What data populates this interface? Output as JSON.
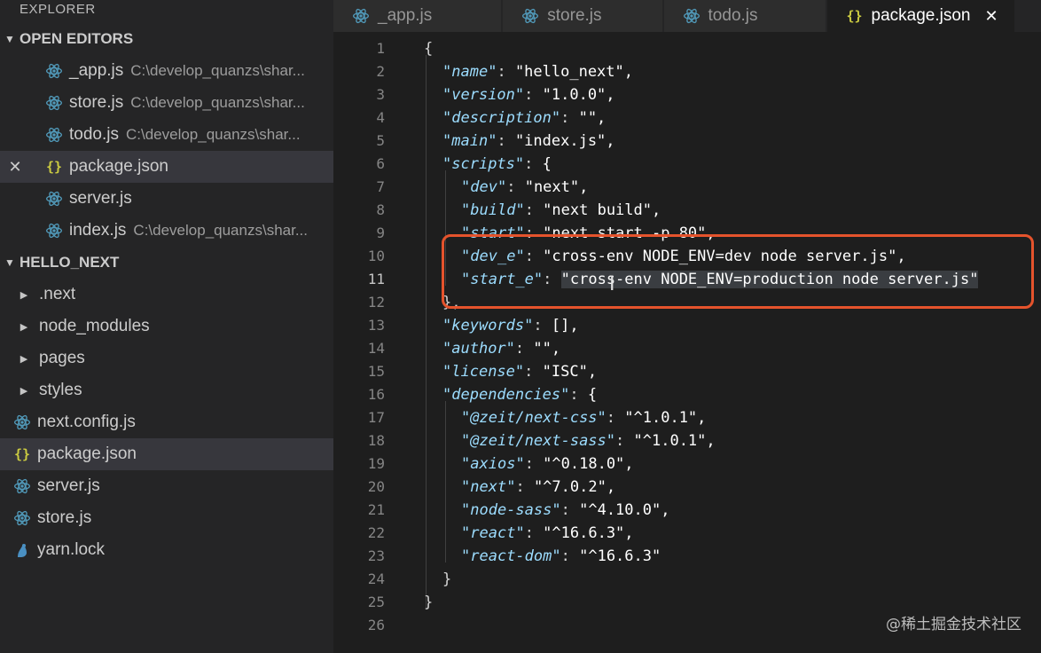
{
  "explorer": {
    "title": "EXPLORER",
    "open_editors": {
      "label": "OPEN EDITORS",
      "items": [
        {
          "name": "_app.js",
          "path": "C:\\develop_quanzs\\shar..."
        },
        {
          "name": "store.js",
          "path": "C:\\develop_quanzs\\shar..."
        },
        {
          "name": "todo.js",
          "path": "C:\\develop_quanzs\\shar..."
        },
        {
          "name": "package.json",
          "path": ""
        },
        {
          "name": "server.js",
          "path": ""
        },
        {
          "name": "index.js",
          "path": "C:\\develop_quanzs\\shar..."
        }
      ]
    },
    "project": {
      "label": "HELLO_NEXT",
      "folders": [
        ".next",
        "node_modules",
        "pages",
        "styles"
      ],
      "files": [
        "next.config.js",
        "package.json",
        "server.js",
        "store.js",
        "yarn.lock"
      ]
    }
  },
  "tabs": [
    {
      "label": "_app.js"
    },
    {
      "label": "store.js"
    },
    {
      "label": "todo.js"
    },
    {
      "label": "package.json"
    }
  ],
  "editor": {
    "line_numbers": [
      "1",
      "2",
      "3",
      "4",
      "5",
      "6",
      "7",
      "8",
      "9",
      "10",
      "11",
      "12",
      "13",
      "14",
      "15",
      "16",
      "17",
      "18",
      "19",
      "20",
      "21",
      "22",
      "23",
      "24",
      "25",
      "26"
    ],
    "current_line": 11,
    "lines": [
      {
        "k": "",
        "v": "{"
      },
      {
        "k": "name",
        "v": "\"hello_next\","
      },
      {
        "k": "version",
        "v": "\"1.0.0\","
      },
      {
        "k": "description",
        "v": "\"\","
      },
      {
        "k": "main",
        "v": "\"index.js\","
      },
      {
        "k": "scripts",
        "v": "{"
      },
      {
        "k": "dev",
        "v": "\"next\","
      },
      {
        "k": "build",
        "v": "\"next build\","
      },
      {
        "k": "start",
        "v": "\"next start -p 80\","
      },
      {
        "k": "dev_e",
        "v": "\"cross-env NODE_ENV=dev node server.js\","
      },
      {
        "k": "start_e",
        "v": "\"cross-env NODE_ENV=production node server.js\""
      },
      {
        "k": "",
        "v": "},"
      },
      {
        "k": "keywords",
        "v": "[],"
      },
      {
        "k": "author",
        "v": "\"\","
      },
      {
        "k": "license",
        "v": "\"ISC\","
      },
      {
        "k": "dependencies",
        "v": "{"
      },
      {
        "k": "@zeit/next-css",
        "v": "\"^1.0.1\","
      },
      {
        "k": "@zeit/next-sass",
        "v": "\"^1.0.1\","
      },
      {
        "k": "axios",
        "v": "\"^0.18.0\","
      },
      {
        "k": "next",
        "v": "\"^7.0.2\","
      },
      {
        "k": "node-sass",
        "v": "\"^4.10.0\","
      },
      {
        "k": "react",
        "v": "\"^16.6.3\","
      },
      {
        "k": "react-dom",
        "v": "\"^16.6.3\""
      },
      {
        "k": "",
        "v": "}"
      },
      {
        "k": "",
        "v": "}"
      },
      {
        "k": "",
        "v": ""
      }
    ]
  },
  "watermark": "@稀土掘金技术社区",
  "colors": {
    "accent_box": "#e5532c",
    "json_icon": "#cbcb41",
    "react_icon": "#519aba"
  }
}
